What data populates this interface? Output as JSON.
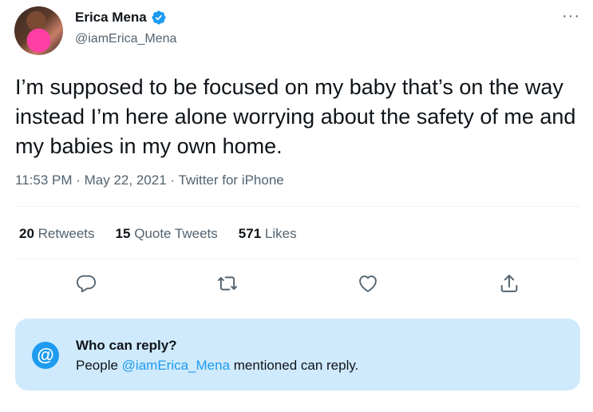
{
  "author": {
    "name": "Erica Mena",
    "handle": "@iamErica_Mena",
    "verified": true
  },
  "tweet": {
    "text": "I’m supposed to be focused on my baby that’s on the way instead I’m here alone worrying about the safety of me and my babies in my own home.",
    "time": "11:53 PM",
    "separator": "·",
    "date": "May 22, 2021",
    "source": "Twitter for iPhone"
  },
  "stats": {
    "retweets_count": "20",
    "retweets_label": "Retweets",
    "quotes_count": "15",
    "quotes_label": "Quote Tweets",
    "likes_count": "571",
    "likes_label": "Likes"
  },
  "actions": [
    "reply-icon",
    "retweet-icon",
    "like-icon",
    "share-icon"
  ],
  "reply_restriction": {
    "title": "Who can reply?",
    "desc_prefix": "People ",
    "mention": "@iamErica_Mena",
    "desc_suffix": " mentioned can reply.",
    "icon": "@"
  },
  "more_icon": "···",
  "colors": {
    "accent": "#1d9bf0",
    "muted": "#536471",
    "reply_box_bg": "#cfeafc"
  }
}
